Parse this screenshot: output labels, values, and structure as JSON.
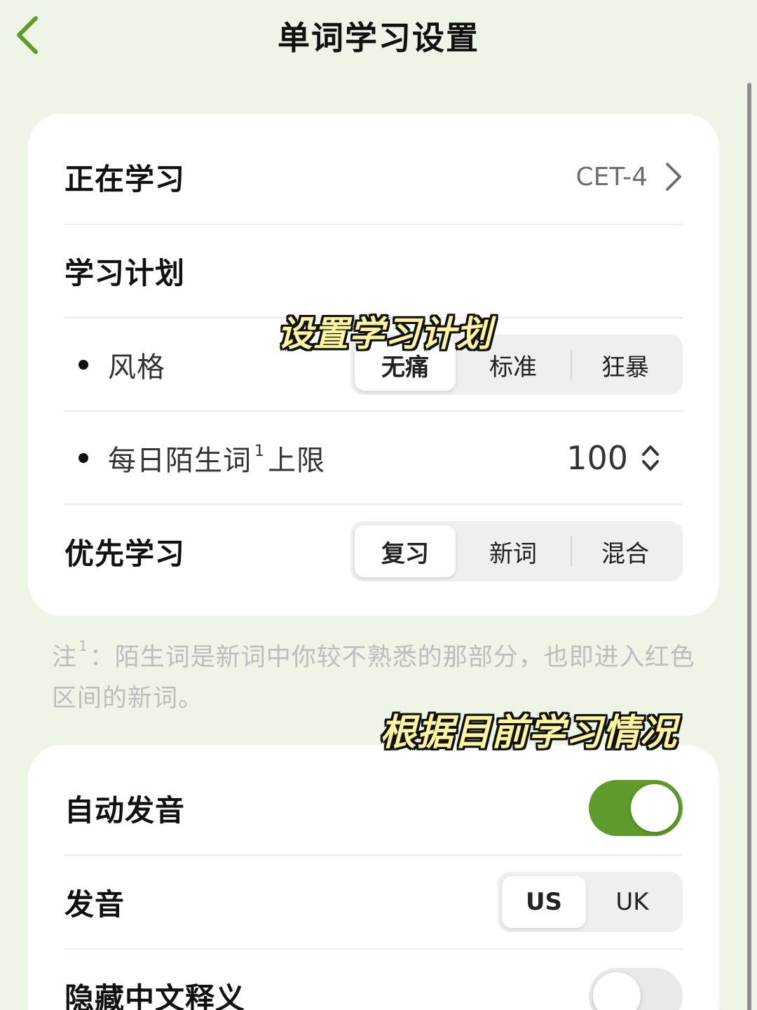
{
  "nav": {
    "title": "单词学习设置",
    "back_icon": "chevron-left-icon",
    "accent_color": "#5f9b2a"
  },
  "card1": {
    "studying": {
      "label": "正在学习",
      "value": "CET-4"
    },
    "plan": {
      "label": "学习计划"
    },
    "style": {
      "label": "风格",
      "options": [
        "无痛",
        "标准",
        "狂暴"
      ],
      "selected": "无痛"
    },
    "daily_limit": {
      "label_main": "每日陌生词",
      "label_sup": "1",
      "label_tail": "上限",
      "value": "100"
    },
    "priority": {
      "label": "优先学习",
      "options": [
        "复习",
        "新词",
        "混合"
      ],
      "selected": "复习"
    }
  },
  "note": {
    "prefix": "注",
    "sup": "1",
    "text": "：陌生词是新词中你较不熟悉的那部分，也即进入红色区间的新词。"
  },
  "captions": {
    "caption1": "设置学习计划",
    "caption2": "根据目前学习情况"
  },
  "card2": {
    "auto_pronounce": {
      "label": "自动发音",
      "on": true
    },
    "pronunciation": {
      "label": "发音",
      "options": [
        "US",
        "UK"
      ],
      "selected": "US"
    },
    "hide_chinese": {
      "label": "隐藏中文释义",
      "on": false
    }
  }
}
